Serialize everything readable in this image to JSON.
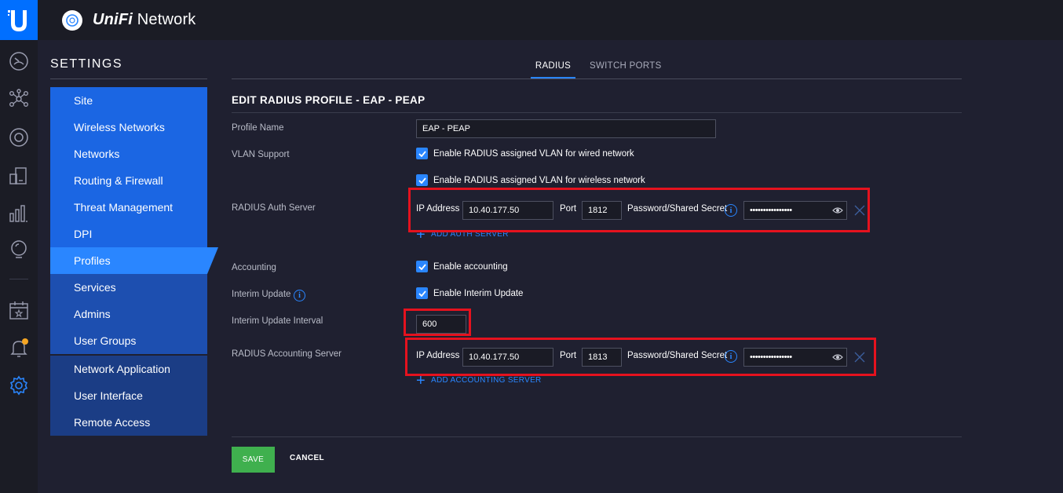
{
  "app": {
    "brand_uni": "UniFi",
    "brand_network": " Network",
    "logo_letter": "U"
  },
  "rail": {
    "icons": [
      "dashboard-icon",
      "topology-icon",
      "devices-icon",
      "clients-icon",
      "statistics-icon",
      "insights-icon",
      "events-icon",
      "alerts-icon",
      "settings-icon"
    ],
    "alert_dot_color": "#f5a623"
  },
  "settings": {
    "title": "SETTINGS",
    "nav": [
      {
        "label": "Site"
      },
      {
        "label": "Wireless Networks"
      },
      {
        "label": "Networks"
      },
      {
        "label": "Routing & Firewall"
      },
      {
        "label": "Threat Management"
      },
      {
        "label": "DPI"
      },
      {
        "label": "Profiles",
        "active": true
      },
      {
        "label": "Services"
      },
      {
        "label": "Admins"
      },
      {
        "label": "User Groups"
      },
      {
        "label": "Network Application"
      },
      {
        "label": "User Interface"
      },
      {
        "label": "Remote Access"
      }
    ]
  },
  "tabs": [
    {
      "label": "RADIUS",
      "active": true
    },
    {
      "label": "SWITCH PORTS"
    }
  ],
  "form": {
    "title": "EDIT RADIUS PROFILE - EAP - PEAP",
    "profile_name_label": "Profile Name",
    "profile_name_value": "EAP - PEAP",
    "vlan_label": "VLAN Support",
    "vlan_wired": "Enable RADIUS assigned VLAN for wired network",
    "vlan_wireless": "Enable RADIUS assigned VLAN for wireless network",
    "auth_server_label": "RADIUS Auth Server",
    "auth": {
      "ip_label": "IP Address",
      "ip_value": "10.40.177.50",
      "port_label": "Port",
      "port_value": "1812",
      "secret_label": "Password/Shared Secret",
      "secret_value": "••••••••••••••••"
    },
    "add_auth_server": "ADD AUTH SERVER",
    "accounting_label": "Accounting",
    "accounting_check": "Enable accounting",
    "interim_label": "Interim Update",
    "interim_check": "Enable Interim Update",
    "interim_interval_label": "Interim Update Interval",
    "interim_interval_value": "600",
    "acct_server_label": "RADIUS Accounting Server",
    "acct": {
      "ip_label": "IP Address",
      "ip_value": "10.40.177.50",
      "port_label": "Port",
      "port_value": "1813",
      "secret_label": "Password/Shared Secret",
      "secret_value": "••••••••••••••••"
    },
    "add_acct_server": "ADD ACCOUNTING SERVER",
    "save_label": "SAVE",
    "cancel_label": "CANCEL"
  },
  "colors": {
    "accent": "#2a86ff",
    "save": "#3fb04e",
    "highlight": "#e5121e"
  }
}
